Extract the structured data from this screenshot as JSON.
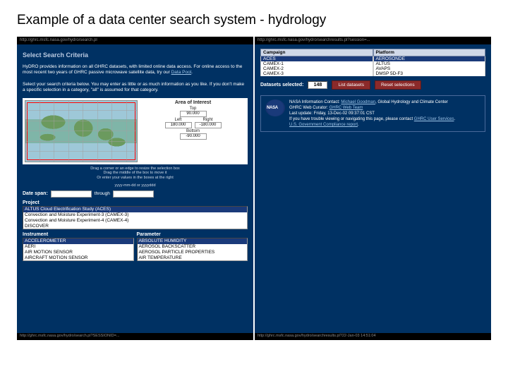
{
  "slide_title": "Example of a data center search system - hydrology",
  "left": {
    "url_top": "http://ghrc.msfc.nasa.gov/hydro/search.pl",
    "select_criteria": "Select Search Criteria",
    "intro": "HyDRO provides information on all GHRC datasets, with limited online data access. For online access to the most recent two years of GHRC passive microwave satellite data, try our ",
    "intro_link": "Data Pool",
    "sub": "Select your search criteria below. You may enter as little or as much information as you like. If you don't make a specific selection in a category, \"all\" is assumed for that category.",
    "aoi": {
      "title": "Area of Interest",
      "top_lbl": "Top",
      "top_val": "90.000",
      "left_lbl": "Left",
      "left_val": "180.000",
      "right_lbl": "Right",
      "right_val": "-180.000",
      "bottom_lbl": "Bottom",
      "bottom_val": "-90.000"
    },
    "map_help1": "Drag a corner or an edge to resize the selection box",
    "map_help2": "Drag the middle of the box to move it",
    "map_help3": "Or enter your values in the boxes at the right",
    "date_fmt": "yyyy-mm-dd or yyyyddd",
    "date_span_lbl": "Date span:",
    "through": "through",
    "project_hdr": "Project",
    "projects": [
      "ALTUS Cloud Electrification Study (ACES)",
      "Convection and Moisture Experiment-3 (CAMEX-3)",
      "Convection and Moisture Experiment-4 (CAMEX-4)",
      "DISCOVER"
    ],
    "instrument_hdr": "Instrument",
    "instruments": [
      "ACCELEROMETER",
      "AERI",
      "AIR MOTION SENSOR",
      "AIRCRAFT MOTION SENSOR"
    ],
    "parameter_hdr": "Parameter",
    "parameters": [
      "ABSOLUTE HUMIDITY",
      "AEROSOL BACKSCATTER",
      "AEROSOL PARTICLE PROPERTIES",
      "AIR TEMPERATURE"
    ],
    "url_bottom": "http://ghrc.msfc.nasa.gov/hydro/search.pl?SESSIONID=..."
  },
  "right": {
    "url_top": "http://ghrc.msfc.nasa.gov/hydro/searchresults.pl?session=...",
    "campaign_hdr": "Campaign",
    "platform_hdr": "Platform",
    "rows": [
      {
        "c": "ACES",
        "p": "AEROSONDE",
        "sel": true
      },
      {
        "c": "CAMEX-1",
        "p": "ALTUS"
      },
      {
        "c": "CAMEX-2",
        "p": "AVAPS"
      },
      {
        "c": "CAMEX-3",
        "p": "DMSP 5D-F3"
      }
    ],
    "ds_sel_lbl": "Datasets selected:",
    "ds_count": "148",
    "btn_list": "List datasets",
    "btn_reset": "Reset selections",
    "meta": {
      "l1a": "NASA Information Contact: ",
      "l1link": "Michael Goodman",
      "l1b": ", Global Hydrology and Climate Center",
      "l2a": "GHRC Web Curator: ",
      "l2link": "GHRC Web Team",
      "l3": "Last update: Friday, 13-Dec-02 09:37:01 CST",
      "l4a": "If you have trouble viewing or navigating this page, please contact ",
      "l4link": "GHRC User Services",
      "l5link": "U.S. Government Compliance report"
    },
    "url_bottom": "http://ghrc.msfc.nasa.gov/hydro/searchresults.pl?22-Jan-03 14:51:04"
  }
}
